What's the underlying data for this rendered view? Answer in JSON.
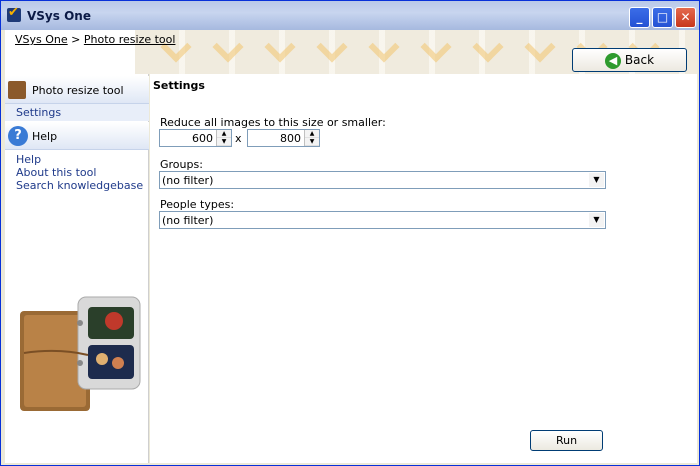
{
  "window": {
    "title": "VSys One",
    "minimize_glyph": "_",
    "maximize_glyph": "□",
    "close_glyph": "✕"
  },
  "breadcrumb": {
    "root": "VSys One",
    "separator": ">",
    "current": "Photo resize tool"
  },
  "toolbar": {
    "back_label": "Back"
  },
  "sidebar": {
    "tool_header": "Photo resize tool",
    "tool_items": [
      {
        "label": "Settings"
      }
    ],
    "help_header": "Help",
    "help_items": [
      {
        "label": "Help"
      },
      {
        "label": "About this tool"
      },
      {
        "label": "Search knowledgebase"
      }
    ]
  },
  "main": {
    "section_title": "Settings",
    "size_label": "Reduce all images to this size or smaller:",
    "width_value": "600",
    "times_glyph": "x",
    "height_value": "800",
    "groups_label": "Groups:",
    "groups_value": "(no filter)",
    "people_types_label": "People types:",
    "people_types_value": "(no filter)",
    "run_label": "Run"
  }
}
